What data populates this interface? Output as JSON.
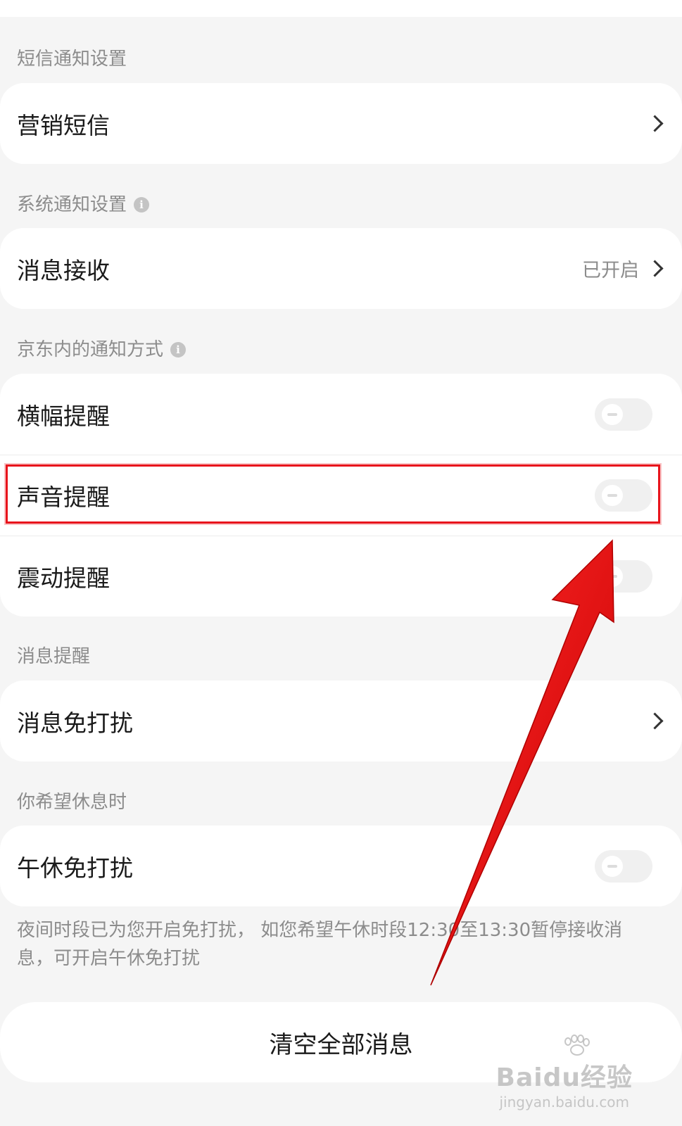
{
  "sections": {
    "sms": {
      "label": "短信通知设置",
      "items": [
        {
          "label": "营销短信"
        }
      ]
    },
    "system": {
      "label": "系统通知设置",
      "items": [
        {
          "label": "消息接收",
          "value": "已开启"
        }
      ]
    },
    "inapp": {
      "label": "京东内的通知方式",
      "items": [
        {
          "label": "横幅提醒",
          "toggle": "off"
        },
        {
          "label": "声音提醒",
          "toggle": "off"
        },
        {
          "label": "震动提醒",
          "toggle": "off"
        }
      ]
    },
    "reminder": {
      "label": "消息提醒",
      "items": [
        {
          "label": "消息免打扰"
        }
      ]
    },
    "rest": {
      "label": "你希望休息时",
      "items": [
        {
          "label": "午休免打扰",
          "toggle": "off"
        }
      ],
      "footnote": "夜间时段已为您开启免打扰， 如您希望午休时段12:30至13:30暂停接收消息，可开启午休免打扰"
    }
  },
  "clear_button": "清空全部消息",
  "watermark": {
    "main": "Baidu经验",
    "sub": "jingyan.baidu.com"
  },
  "colors": {
    "annotation": "#e8141c",
    "background": "#f5f5f5"
  },
  "icons": [
    "info-icon",
    "chevron-right-icon",
    "toggle-switch"
  ]
}
